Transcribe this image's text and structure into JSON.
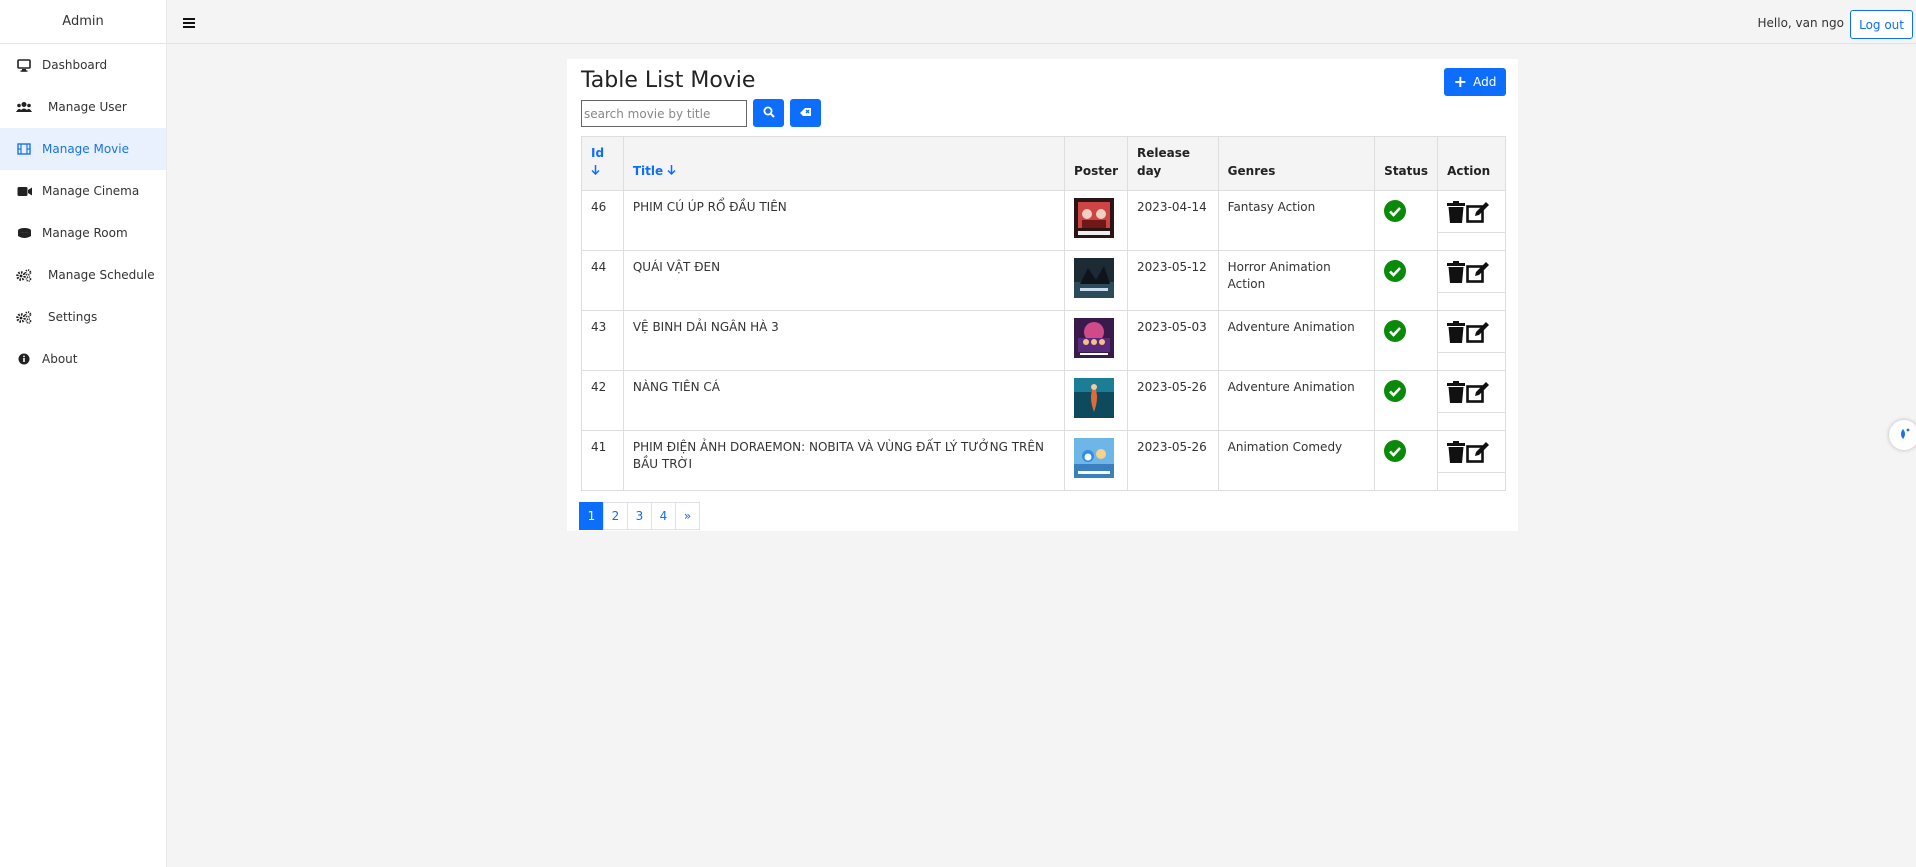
{
  "sidebar": {
    "brand": "Admin",
    "items": [
      {
        "label": "Dashboard",
        "icon": "monitor-icon"
      },
      {
        "label": "Manage User",
        "icon": "users-icon"
      },
      {
        "label": "Manage Movie",
        "icon": "film-icon"
      },
      {
        "label": "Manage Cinema",
        "icon": "video-camera-icon"
      },
      {
        "label": "Manage Room",
        "icon": "room-icon"
      },
      {
        "label": "Manage Schedule",
        "icon": "gears-icon"
      },
      {
        "label": "Settings",
        "icon": "gears-icon"
      },
      {
        "label": "About",
        "icon": "info-icon"
      }
    ],
    "active_index": 2
  },
  "topbar": {
    "greeting": "Hello,  van ngo",
    "logout_label": "Log out"
  },
  "main": {
    "title": "Table List Movie",
    "add_label": "Add",
    "search_placeholder": "search movie by title",
    "search_value": "",
    "columns": {
      "id": "Id",
      "title": "Title",
      "poster": "Poster",
      "release": "Release day",
      "genres": "Genres",
      "status": "Status",
      "action": "Action"
    },
    "rows": [
      {
        "id": "46",
        "title": "PHIM CÚ ÚP RỔ ĐẦU TIÊN",
        "release": "2023-04-14",
        "genres": "Fantasy Action",
        "status": "active"
      },
      {
        "id": "44",
        "title": "QUÁI VẬT ĐEN",
        "release": "2023-05-12",
        "genres": "Horror Animation Action",
        "status": "active"
      },
      {
        "id": "43",
        "title": "VỆ BINH DẢI NGÂN HÀ 3",
        "release": "2023-05-03",
        "genres": "Adventure Animation",
        "status": "active"
      },
      {
        "id": "42",
        "title": "NÀNG TIÊN CÁ",
        "release": "2023-05-26",
        "genres": "Adventure Animation",
        "status": "active"
      },
      {
        "id": "41",
        "title": "PHIM ĐIỆN ẢNH DORAEMON: NOBITA VÀ VÙNG ĐẤT LÝ TƯỞNG TRÊN BẦU TRỜI",
        "release": "2023-05-26",
        "genres": "Animation Comedy",
        "status": "active"
      }
    ],
    "pagination": {
      "pages": [
        "1",
        "2",
        "3",
        "4"
      ],
      "next": "»",
      "current": "1"
    }
  },
  "colors": {
    "accent": "#0d6efd",
    "status_ok": "#0a8a0a",
    "active_nav_bg": "#e8f1fd"
  }
}
